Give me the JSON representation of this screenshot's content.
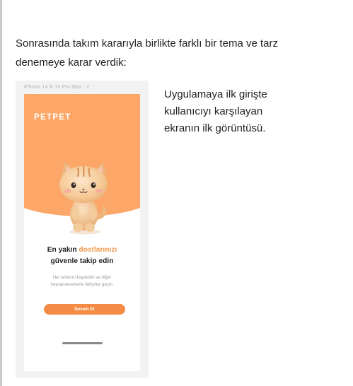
{
  "intro_text": "Sonrasında takım kararıyla birlikte farklı bir tema ve tarz denemeye karar verdik:",
  "frame": {
    "label": "iPhone 14 & 15 Pro Max - 2"
  },
  "app": {
    "brand": "PETPET",
    "headline_part1": "En yakın ",
    "headline_accent": "dostlarınızı",
    "headline_part2": "güvenle takip edin",
    "subtext": "Her anlarını kaydedin ve diğer hayvanseverlerle iletişime geçin.",
    "cta_label": "Devam Et",
    "hero_icon": "cat-mascot",
    "colors": {
      "hero_bg": "#fca768",
      "accent": "#f59a4f",
      "button": "#f48c45"
    }
  },
  "caption": "Uygulamaya ilk girişte kullanıcıyı karşılayan ekranın ilk görüntüsü."
}
